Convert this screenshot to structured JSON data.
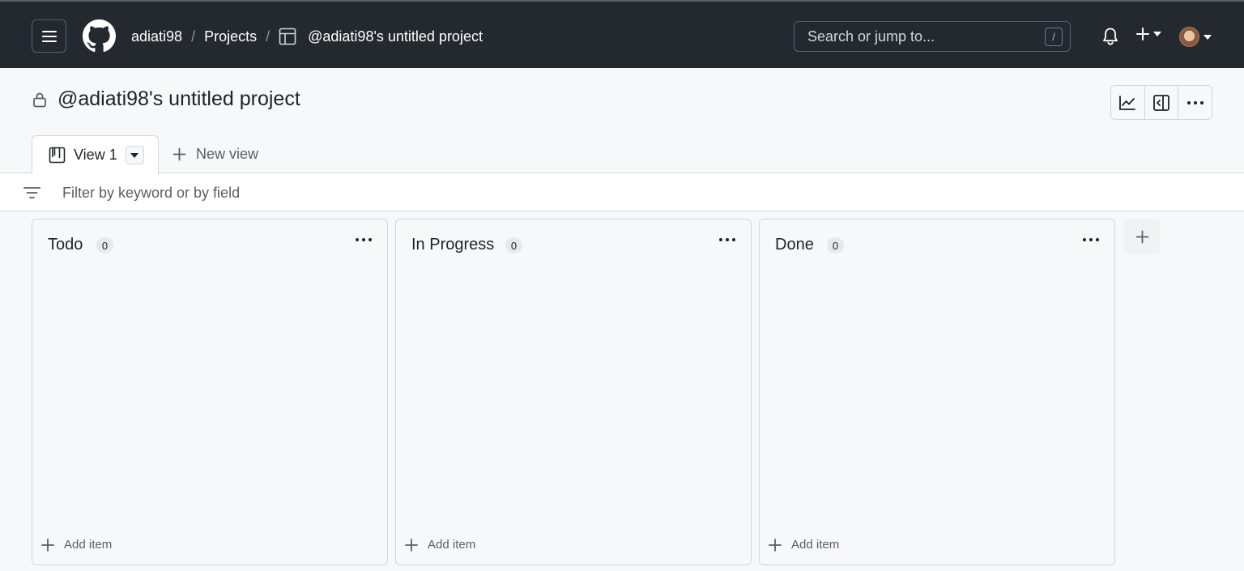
{
  "header": {
    "owner": "adiati98",
    "projects_label": "Projects",
    "project_name": "@adiati98's untitled project",
    "search_placeholder": "Search or jump to...",
    "search_shortcut": "/",
    "icons": [
      "hamburger-icon",
      "github-logo-icon",
      "table-icon",
      "bell-icon",
      "plus-icon",
      "caret-down-icon",
      "avatar"
    ]
  },
  "project": {
    "title": "@adiati98's untitled project",
    "lock_icon": "lock-icon",
    "actions": [
      "insights-icon",
      "side-panel-icon",
      "kebab-icon"
    ]
  },
  "tabs": {
    "active": "View 1",
    "new_view": "New view"
  },
  "filter": {
    "placeholder": "Filter by keyword or by field"
  },
  "board": {
    "columns": [
      {
        "title": "Todo",
        "count": "0",
        "add_label": "Add item"
      },
      {
        "title": "In Progress",
        "count": "0",
        "add_label": "Add item"
      },
      {
        "title": "Done",
        "count": "0",
        "add_label": "Add item"
      }
    ]
  },
  "colors": {
    "header_bg": "#24292f",
    "page_bg": "#f6f8fa",
    "border": "#d0d7de"
  }
}
